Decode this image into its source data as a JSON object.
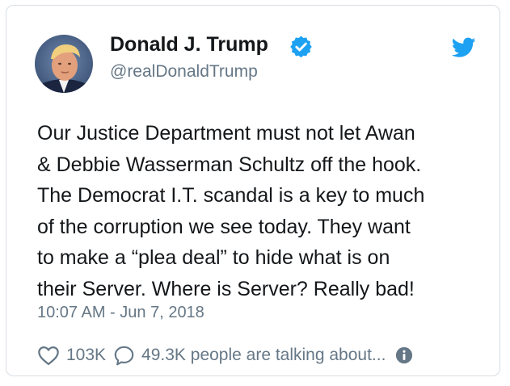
{
  "tweet": {
    "display_name": "Donald J. Trump",
    "handle": "@realDonaldTrump",
    "verified": true,
    "text_lines": [
      "Our Justice Department must not let Awan",
      "& Debbie Wasserman Schultz off the hook.",
      "The Democrat I.T. scandal is a key to much",
      "of the corruption we see today. They want",
      "to make a “plea deal” to hide what is on",
      "their Server. Where is Server? Really bad!"
    ],
    "timestamp": "10:07 AM - Jun 7, 2018",
    "likes": "103K",
    "talking": "49.3K people are talking about..."
  },
  "icons": {
    "brand": "twitter-bird-icon",
    "verified": "verified-badge-icon",
    "like": "heart-icon",
    "reply": "speech-bubble-icon",
    "info": "info-icon"
  },
  "colors": {
    "brand_blue": "#1da1f2",
    "text": "#14171a",
    "secondary_text": "#657786",
    "border": "#d9dee3"
  }
}
